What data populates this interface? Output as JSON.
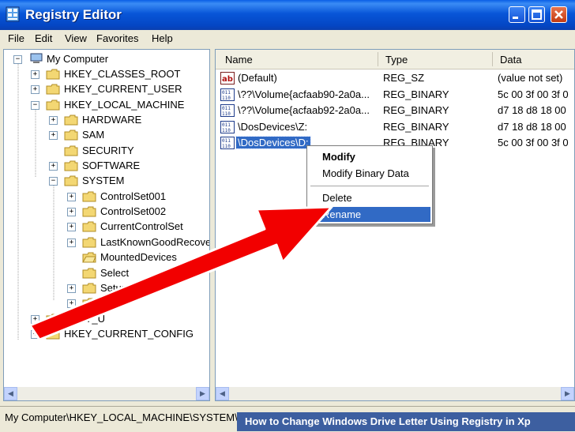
{
  "window": {
    "title": "Registry Editor",
    "accent": "#0a5fe6",
    "buttons": [
      "minimize-icon",
      "maximize-icon",
      "close-icon"
    ]
  },
  "menu": [
    "File",
    "Edit",
    "View",
    "Favorites",
    "Help"
  ],
  "tree": {
    "root": "My Computer",
    "hkcr": "HKEY_CLASSES_ROOT",
    "hkcu": "HKEY_CURRENT_USER",
    "hklm": "HKEY_LOCAL_MACHINE",
    "hardware": "HARDWARE",
    "sam": "SAM",
    "security": "SECURITY",
    "software": "SOFTWARE",
    "system": "SYSTEM",
    "cs001": "ControlSet001",
    "cs002": "ControlSet002",
    "ccs": "CurrentControlSet",
    "lkg": "LastKnownGoodRecove",
    "mounted": "MountedDevices",
    "select": "Select",
    "setup": "Setup",
    "wpa": "WPA",
    "hku": "HKEY_U",
    "hkcc": "HKEY_CURRENT_CONFIG"
  },
  "list": {
    "headers": {
      "name": "Name",
      "type": "Type",
      "data": "Data"
    },
    "rows": [
      {
        "name": "(Default)",
        "type": "REG_SZ",
        "data": "(value not set)",
        "icon": "string-value-icon"
      },
      {
        "name": "\\??\\Volume{acfaab90-2a0a...",
        "type": "REG_BINARY",
        "data": "5c 00 3f 00 3f 0",
        "icon": "binary-value-icon"
      },
      {
        "name": "\\??\\Volume{acfaab92-2a0a...",
        "type": "REG_BINARY",
        "data": "d7 18 d8 18 00",
        "icon": "binary-value-icon"
      },
      {
        "name": "\\DosDevices\\Z:",
        "type": "REG_BINARY",
        "data": "d7 18 d8 18 00",
        "icon": "binary-value-icon"
      },
      {
        "name": "\\DosDevices\\D:",
        "type": "REG_BINARY",
        "data": "5c 00 3f 00 3f 0",
        "icon": "binary-value-icon"
      }
    ]
  },
  "context_menu": {
    "modify": "Modify",
    "modify_binary": "Modify Binary Data",
    "delete": "Delete",
    "rename": "Rename"
  },
  "status": "My Computer\\HKEY_LOCAL_MACHINE\\SYSTEM\\MountedDevices",
  "banner": "How to Change Windows Drive Letter Using Registry in Xp",
  "colors": {
    "selection": "#316ac5",
    "arrow": "#ff0000"
  }
}
